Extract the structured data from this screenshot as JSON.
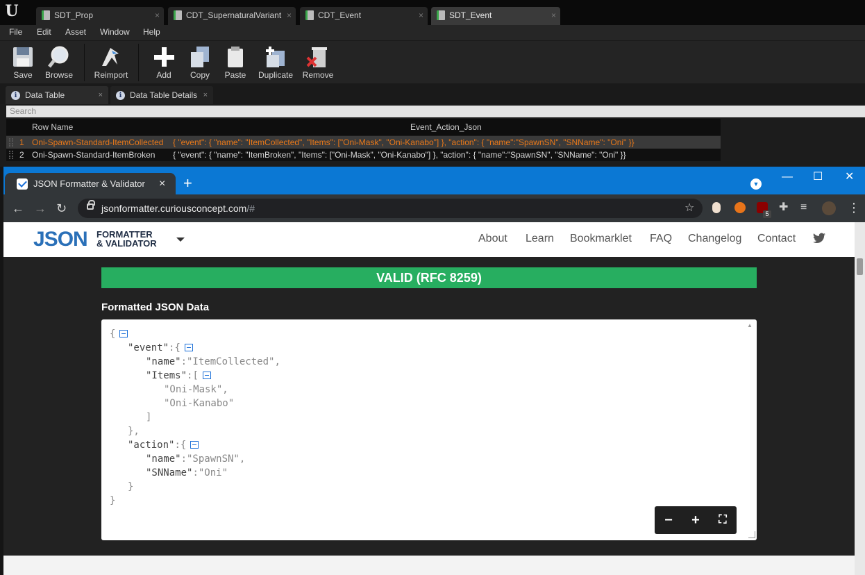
{
  "ue": {
    "logo": "U",
    "doc_tabs": [
      {
        "label": "SDT_Prop",
        "close": "×"
      },
      {
        "label": "CDT_SupernaturalVariant",
        "close": "×"
      },
      {
        "label": "CDT_Event",
        "close": "×"
      },
      {
        "label": "SDT_Event",
        "close": "×"
      }
    ],
    "menu": [
      "File",
      "Edit",
      "Asset",
      "Window",
      "Help"
    ],
    "toolbar": [
      {
        "label": "Save",
        "icon": "save-icon"
      },
      {
        "label": "Browse",
        "icon": "browse-icon"
      },
      {
        "label": "Reimport",
        "icon": "reimport-icon"
      },
      {
        "label": "Add",
        "icon": "add-icon"
      },
      {
        "label": "Copy",
        "icon": "copy-icon"
      },
      {
        "label": "Paste",
        "icon": "paste-icon"
      },
      {
        "label": "Duplicate",
        "icon": "duplicate-icon"
      },
      {
        "label": "Remove",
        "icon": "remove-icon"
      }
    ],
    "panel_tabs": [
      {
        "label": "Data Table",
        "icon": "info",
        "close": "×"
      },
      {
        "label": "Data Table Details",
        "icon": "info",
        "close": "×"
      }
    ],
    "search_placeholder": "Search",
    "table": {
      "headers": [
        "Row Name",
        "Event_Action_Json"
      ],
      "rows": [
        {
          "index": "1",
          "name": "Oni-Spawn-Standard-ItemCollected",
          "json": "{ \"event\": {   \"name\": \"ItemCollected\",   \"Items\": [\"Oni-Mask\", \"Oni-Kanabo\"] },   \"action\":  { \"name\":\"SpawnSN\",   \"SNName\": \"Oni\" }}",
          "selected": true
        },
        {
          "index": "2",
          "name": "Oni-Spawn-Standard-ItemBroken",
          "json": "{ \"event\": {   \"name\": \"ItemBroken\",   \"Items\": [\"Oni-Mask\", \"Oni-Kanabo\"] },   \"action\":  { \"name\":\"SpawnSN\",   \"SNName\": \"Oni\" }}",
          "selected": false
        }
      ]
    },
    "colors": {
      "selected_row_text": "#e8781a",
      "selected_row_bg": "#3a3a3a"
    }
  },
  "browser": {
    "tab_title": "JSON Formatter & Validator",
    "tab_close": "×",
    "new_tab": "+",
    "url_host": "jsonformatter.curiousconcept.com",
    "url_path": "/#",
    "window_controls": [
      "—",
      "☐",
      "✕"
    ],
    "nav": [
      "←",
      "→",
      "↻"
    ],
    "star": "☆",
    "extensions": [
      "ext-1",
      "ext-2",
      "ublock-icon",
      "puzzle-icon",
      "media-icon",
      "avatar"
    ],
    "ublock_badge": "5",
    "menu": "⋮"
  },
  "site": {
    "logo_main": "JSON",
    "logo_line1": "FORMATTER",
    "logo_line2": "& VALIDATOR",
    "nav": [
      "About",
      "Learn",
      "Bookmarklet",
      "FAQ",
      "Changelog",
      "Contact"
    ],
    "status": "VALID (RFC 8259)",
    "formatted_title": "Formatted JSON Data",
    "zoom": [
      "−",
      "+",
      "⛶"
    ],
    "colors": {
      "valid": "#27ae60",
      "brand": "#2a70b8"
    }
  },
  "json_lines": [
    {
      "indent": 0,
      "parts": [
        [
          "p",
          "{"
        ]
      ],
      "toggle": true
    },
    {
      "indent": 1,
      "parts": [
        [
          "k",
          "\"event\""
        ],
        [
          "p",
          ":{"
        ]
      ],
      "toggle": true
    },
    {
      "indent": 2,
      "parts": [
        [
          "k",
          "\"name\""
        ],
        [
          "p",
          ":\"ItemCollected\","
        ]
      ]
    },
    {
      "indent": 2,
      "parts": [
        [
          "k",
          "\"Items\""
        ],
        [
          "p",
          ":["
        ]
      ],
      "toggle": true
    },
    {
      "indent": 3,
      "parts": [
        [
          "p",
          "\"Oni-Mask\","
        ]
      ]
    },
    {
      "indent": 3,
      "parts": [
        [
          "p",
          "\"Oni-Kanabo\""
        ]
      ]
    },
    {
      "indent": 2,
      "parts": [
        [
          "p",
          "]"
        ]
      ]
    },
    {
      "indent": 1,
      "parts": [
        [
          "p",
          "},"
        ]
      ]
    },
    {
      "indent": 1,
      "parts": [
        [
          "k",
          "\"action\""
        ],
        [
          "p",
          ":{"
        ]
      ],
      "toggle": true
    },
    {
      "indent": 2,
      "parts": [
        [
          "k",
          "\"name\""
        ],
        [
          "p",
          ":\"SpawnSN\","
        ]
      ]
    },
    {
      "indent": 2,
      "parts": [
        [
          "k",
          "\"SNName\""
        ],
        [
          "p",
          ":\"Oni\""
        ]
      ]
    },
    {
      "indent": 1,
      "parts": [
        [
          "p",
          "}"
        ]
      ]
    },
    {
      "indent": 0,
      "parts": [
        [
          "p",
          "}"
        ]
      ]
    }
  ]
}
